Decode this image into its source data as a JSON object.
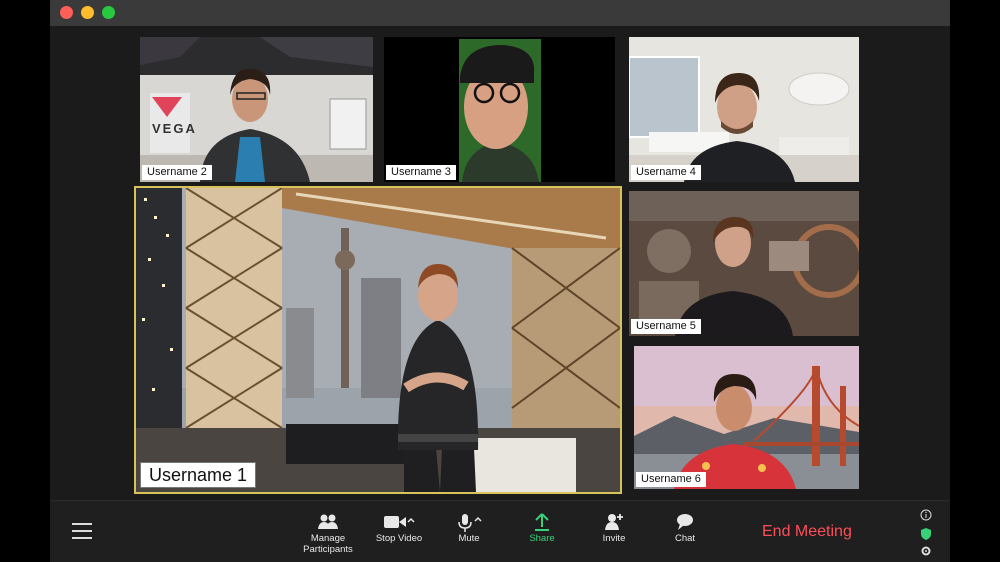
{
  "participants": [
    {
      "id": "p2",
      "name": "Username 2",
      "logo_text": "VEGA"
    },
    {
      "id": "p3",
      "name": "Username 3"
    },
    {
      "id": "p4",
      "name": "Username 4"
    },
    {
      "id": "p1",
      "name": "Username 1",
      "active_speaker": true
    },
    {
      "id": "p5",
      "name": "Username 5"
    },
    {
      "id": "p6",
      "name": "Username 6"
    }
  ],
  "toolbar": {
    "manage_participants_line1": "Manage",
    "manage_participants_line2": "Participants",
    "stop_video": "Stop Video",
    "mute": "Mute",
    "share": "Share",
    "invite": "Invite",
    "chat": "Chat",
    "end_meeting": "End Meeting"
  },
  "colors": {
    "active_speaker_border": "#d8c35a",
    "share_accent": "#39d07a",
    "end_meeting": "#ff4d5a",
    "security_shield": "#39d07a"
  }
}
